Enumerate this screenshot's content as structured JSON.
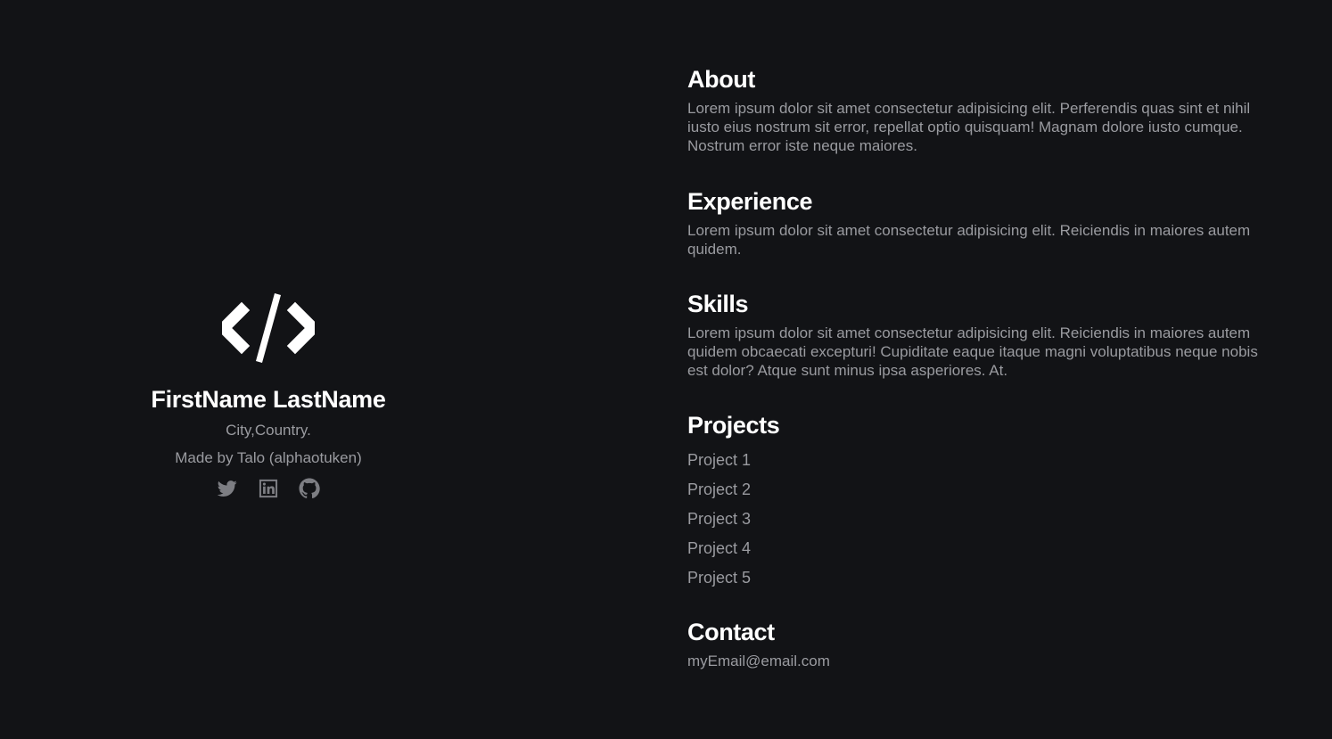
{
  "profile": {
    "logo_icon": "code-brackets-icon",
    "name": "FirstName LastName",
    "location": "City,Country.",
    "credit": "Made by Talo (alphaotuken)",
    "socials": [
      {
        "icon": "twitter-icon"
      },
      {
        "icon": "linkedin-icon"
      },
      {
        "icon": "github-icon"
      }
    ]
  },
  "sections": {
    "about": {
      "title": "About",
      "text": "Lorem ipsum dolor sit amet consectetur adipisicing elit. Perferendis quas sint et nihil iusto eius nostrum sit error, repellat optio quisquam! Magnam dolore iusto cumque. Nostrum error iste neque maiores."
    },
    "experience": {
      "title": "Experience",
      "text": "Lorem ipsum dolor sit amet consectetur adipisicing elit. Reiciendis in maiores autem quidem."
    },
    "skills": {
      "title": "Skills",
      "text": "Lorem ipsum dolor sit amet consectetur adipisicing elit. Reiciendis in maiores autem quidem obcaecati excepturi! Cupiditate eaque itaque magni voluptatibus neque nobis est dolor? Atque sunt minus ipsa asperiores. At."
    },
    "projects": {
      "title": "Projects",
      "items": [
        "Project 1",
        "Project 2",
        "Project 3",
        "Project 4",
        "Project 5"
      ]
    },
    "contact": {
      "title": "Contact",
      "email": "myEmail@email.com"
    }
  },
  "colors": {
    "background": "#121316",
    "heading": "#ffffff",
    "muted": "#9a9ba0",
    "icon": "#7d7e83"
  }
}
